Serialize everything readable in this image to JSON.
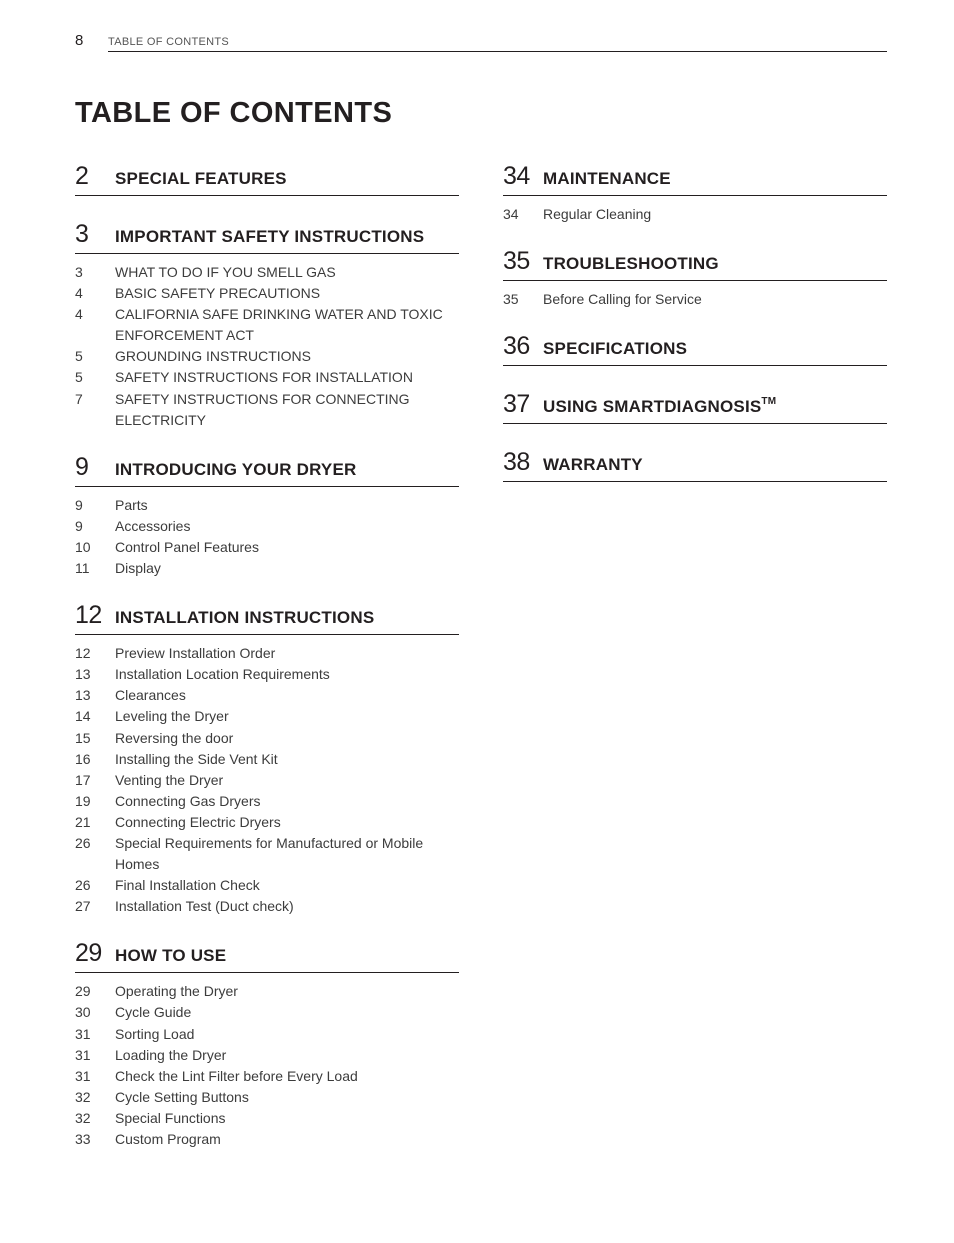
{
  "header": {
    "page_number": "8",
    "running_title": "TABLE OF CONTENTS"
  },
  "title": "TABLE OF CONTENTS",
  "left_column": [
    {
      "page": "2",
      "title": "SPECIAL FEATURES",
      "items": []
    },
    {
      "page": "3",
      "title": "IMPORTANT SAFETY INSTRUCTIONS",
      "items": [
        {
          "page": "3",
          "label": "WHAT TO DO IF YOU SMELL GAS"
        },
        {
          "page": "4",
          "label": "BASIC SAFETY PRECAUTIONS"
        },
        {
          "page": "4",
          "label": "CALIFORNIA SAFE DRINKING WATER AND TOXIC ENFORCEMENT ACT"
        },
        {
          "page": "5",
          "label": "GROUNDING INSTRUCTIONS"
        },
        {
          "page": "5",
          "label": "SAFETY INSTRUCTIONS FOR INSTALLATION"
        },
        {
          "page": "7",
          "label": "SAFETY INSTRUCTIONS FOR CONNECTING ELECTRICITY"
        }
      ]
    },
    {
      "page": "9",
      "title": "INTRODUCING YOUR DRYER",
      "items": [
        {
          "page": "9",
          "label": "Parts"
        },
        {
          "page": "9",
          "label": "Accessories"
        },
        {
          "page": "10",
          "label": "Control Panel Features"
        },
        {
          "page": "11",
          "label": "Display"
        }
      ]
    },
    {
      "page": "12",
      "title": "INSTALLATION INSTRUCTIONS",
      "items": [
        {
          "page": "12",
          "label": "Preview Installation Order"
        },
        {
          "page": "13",
          "label": "Installation Location Requirements"
        },
        {
          "page": "13",
          "label": "Clearances"
        },
        {
          "page": "14",
          "label": "Leveling the Dryer"
        },
        {
          "page": "15",
          "label": "Reversing the door"
        },
        {
          "page": "16",
          "label": "Installing the Side Vent Kit"
        },
        {
          "page": "17",
          "label": "Venting the Dryer"
        },
        {
          "page": "19",
          "label": "Connecting Gas Dryers"
        },
        {
          "page": "21",
          "label": "Connecting Electric Dryers"
        },
        {
          "page": "26",
          "label": "Special Requirements for Manufactured or Mobile Homes"
        },
        {
          "page": "26",
          "label": "Final Installation Check"
        },
        {
          "page": "27",
          "label": "Installation Test (Duct check)"
        }
      ]
    },
    {
      "page": "29",
      "title": "HOW TO USE",
      "items": [
        {
          "page": "29",
          "label": "Operating the Dryer"
        },
        {
          "page": "30",
          "label": "Cycle Guide"
        },
        {
          "page": "31",
          "label": "Sorting Load"
        },
        {
          "page": "31",
          "label": "Loading the Dryer"
        },
        {
          "page": "31",
          "label": "Check the Lint Filter before Every Load"
        },
        {
          "page": "32",
          "label": "Cycle Setting Buttons"
        },
        {
          "page": "32",
          "label": "Special Functions"
        },
        {
          "page": "33",
          "label": "Custom Program"
        }
      ]
    }
  ],
  "right_column": [
    {
      "page": "34",
      "title": "MAINTENANCE",
      "items": [
        {
          "page": "34",
          "label": "Regular Cleaning"
        }
      ]
    },
    {
      "page": "35",
      "title": "TROUBLESHOOTING",
      "items": [
        {
          "page": "35",
          "label": "Before Calling for Service"
        }
      ]
    },
    {
      "page": "36",
      "title": "SPECIFICATIONS",
      "items": []
    },
    {
      "page": "37",
      "title": "USING SMARTDIAGNOSIS",
      "title_superscript": "TM",
      "items": []
    },
    {
      "page": "38",
      "title": "WARRANTY",
      "items": []
    }
  ]
}
